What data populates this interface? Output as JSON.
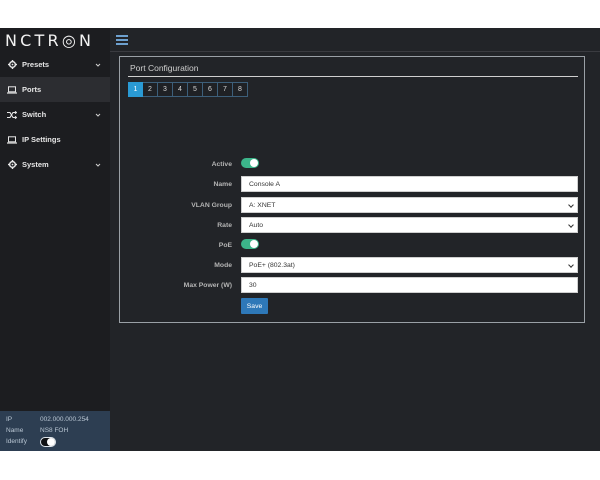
{
  "brand": {
    "logo_text": "NCTR◎N"
  },
  "sidebar": {
    "items": [
      {
        "label": "Presets",
        "icon": "gear-icon",
        "has_chevron": true,
        "active": false
      },
      {
        "label": "Ports",
        "icon": "laptop-icon",
        "has_chevron": false,
        "active": true
      },
      {
        "label": "Switch",
        "icon": "shuffle-icon",
        "has_chevron": true,
        "active": false
      },
      {
        "label": "IP Settings",
        "icon": "laptop-icon",
        "has_chevron": false,
        "active": false
      },
      {
        "label": "System",
        "icon": "gear-icon",
        "has_chevron": true,
        "active": false
      }
    ],
    "footer": {
      "ip_label": "IP",
      "ip_value": "002.000.000.254",
      "name_label": "Name",
      "name_value": "NS8 FOH",
      "identify_label": "Identify"
    }
  },
  "panel": {
    "title": "Port Configuration",
    "ports": [
      "1",
      "2",
      "3",
      "4",
      "5",
      "6",
      "7",
      "8"
    ],
    "selected_port": "1"
  },
  "form": {
    "active_label": "Active",
    "name_label": "Name",
    "name_value": "Console A",
    "vlan_label": "VLAN Group",
    "vlan_value": "A:  XNET",
    "rate_label": "Rate",
    "rate_value": "Auto",
    "poe_label": "PoE",
    "mode_label": "Mode",
    "mode_value": "PoE+ (802.3at)",
    "maxpower_label": "Max Power (W)",
    "maxpower_value": "30",
    "save_label": "Save"
  },
  "colors": {
    "accent": "#2a9ad4",
    "toggle_on": "#3cb58a",
    "button": "#2e78b8",
    "sidebar_footer": "#2d3e52"
  }
}
